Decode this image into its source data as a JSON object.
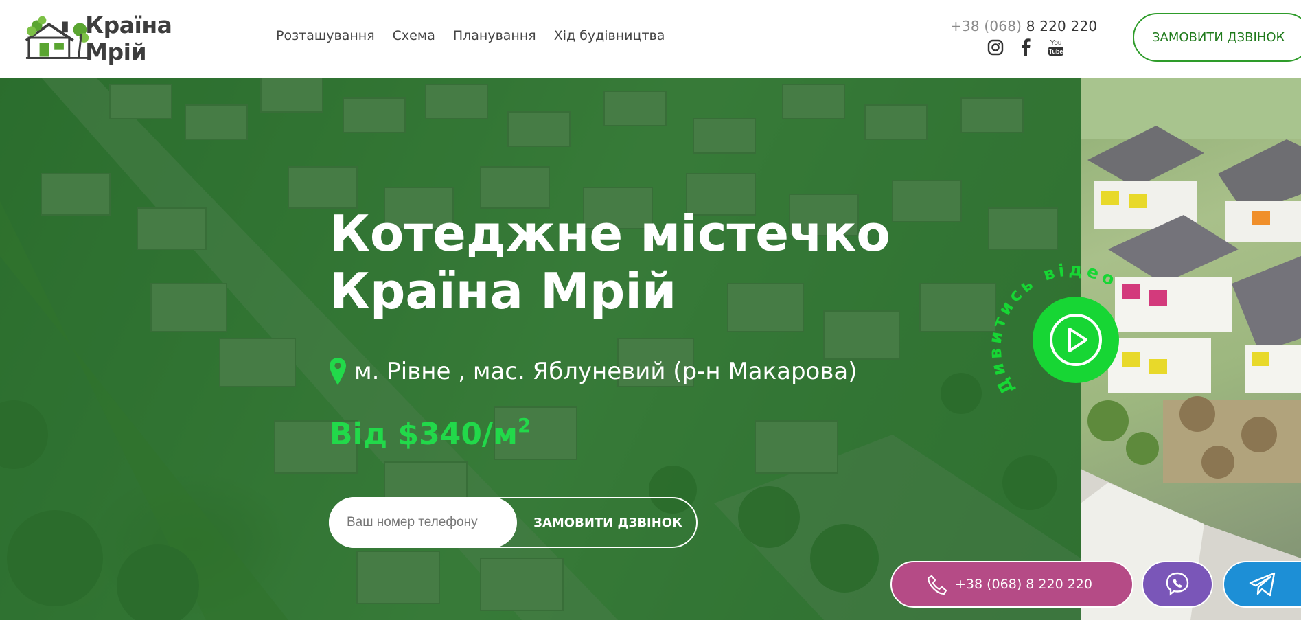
{
  "header": {
    "logo_text": "Країна Мрій",
    "nav": [
      "Розташування",
      "Схема",
      "Планування",
      "Хід будівництва"
    ],
    "phone_prefix": "+38 (068)",
    "phone_number": "8 220 220",
    "socials": [
      "instagram-icon",
      "facebook-icon",
      "youtube-icon"
    ],
    "callback_label": "ЗАМОВИТИ ДЗВІНОК"
  },
  "hero": {
    "title_line1": "Котеджне містечко",
    "title_line2": "Країна Мрій",
    "location": "м. Рівне , мас. Яблуневий (р-н Макарова)",
    "price_prefix": "Від $340/м",
    "price_sup": "2",
    "phone_placeholder": "Ваш номер телефону",
    "submit_label": "ЗАМОВИТИ ДЗВІНОК",
    "video_label": "Дивитись відео"
  },
  "floating": {
    "phone_label": "+38 (068) 8 220 220",
    "viber_icon": "viber-icon",
    "telegram_icon": "telegram-icon"
  },
  "colors": {
    "brand_green": "#22d94a",
    "border_green": "#2e9c2a",
    "phone_button": "#b54b86",
    "viber": "#7a56b8",
    "telegram": "#1d8fd6"
  }
}
